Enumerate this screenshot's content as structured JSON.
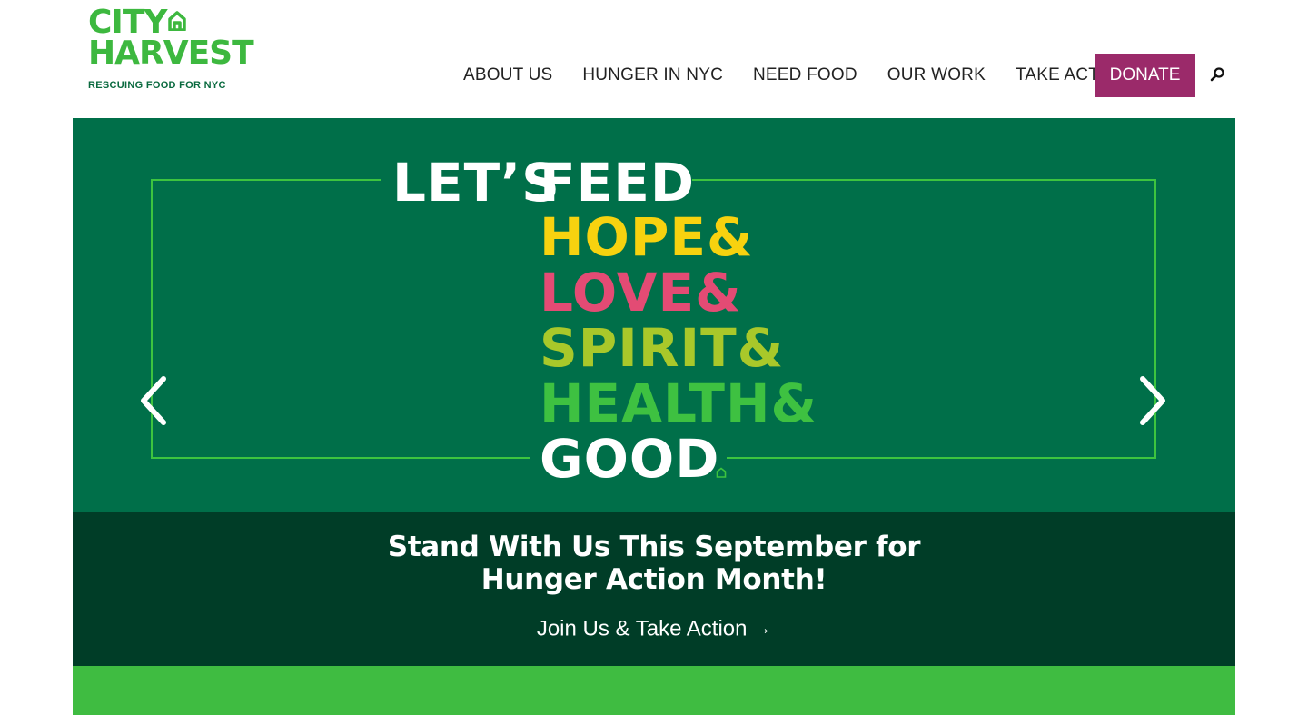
{
  "brand": {
    "name_line1": "CITY",
    "name_line2": "HARVEST",
    "tagline": "RESCUING FOOD FOR NYC"
  },
  "nav": {
    "items": [
      {
        "label": "ABOUT US"
      },
      {
        "label": "HUNGER IN NYC"
      },
      {
        "label": "NEED FOOD"
      },
      {
        "label": "OUR WORK"
      },
      {
        "label": "TAKE ACTION"
      }
    ],
    "donate_label": "DONATE",
    "search_icon": "search-icon"
  },
  "hero": {
    "words": {
      "lets": "LET’S",
      "feed": "FEED",
      "hope": "HOPE&",
      "love": "LOVE&",
      "spirit": "SPIRIT&",
      "health": "HEALTH&",
      "good": "GOOD"
    },
    "prev_icon": "chevron-left-icon",
    "next_icon": "chevron-right-icon"
  },
  "banner": {
    "title_line1": "Stand With Us This September for",
    "title_line2": "Hunger Action Month!",
    "link_label": "Join Us & Take Action",
    "link_arrow": "→"
  },
  "colors": {
    "brand_green": "#3db83f",
    "hero_green": "#006f49",
    "banner_green": "#003d27",
    "donate_purple": "#9b2a6a",
    "hope_yellow": "#f7d20f",
    "love_pink": "#e34b74",
    "spirit_lime": "#a9c82a",
    "health_green": "#3ec141"
  }
}
